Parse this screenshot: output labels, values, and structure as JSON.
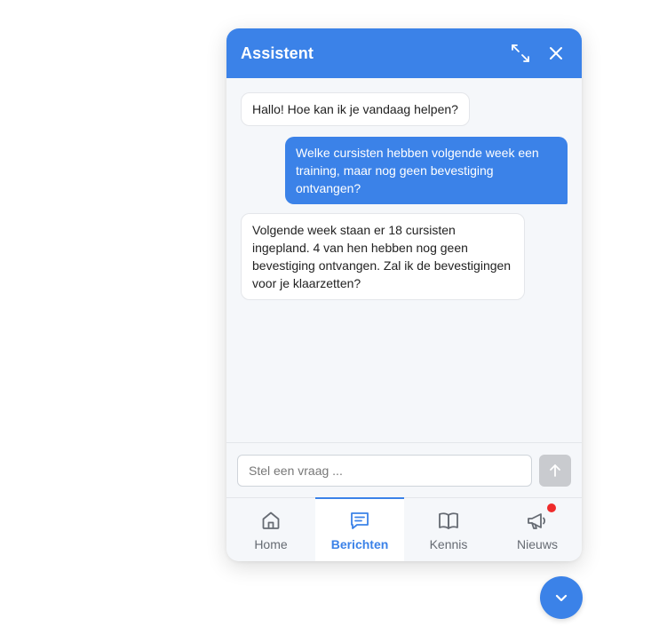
{
  "header": {
    "title": "Assistent",
    "expand_icon": "expand-icon",
    "close_icon": "close-icon"
  },
  "messages": [
    {
      "role": "assistant",
      "text": "Hallo! Hoe kan ik je vandaag helpen?"
    },
    {
      "role": "user",
      "text": "Welke cursisten hebben volgende week een training, maar nog geen bevestiging ontvangen?"
    },
    {
      "role": "assistant",
      "text": "Volgende week staan er 18 cursisten ingepland. 4 van hen hebben nog geen bevestiging ontvangen. Zal ik de bevestigingen voor je klaarzetten?"
    }
  ],
  "composer": {
    "placeholder": "Stel een vraag ...",
    "value": "",
    "send_icon": "arrow-up-icon"
  },
  "nav": {
    "items": [
      {
        "label": "Home",
        "icon": "home-icon",
        "active": false
      },
      {
        "label": "Berichten",
        "icon": "message-icon",
        "active": true
      },
      {
        "label": "Kennis",
        "icon": "book-icon",
        "active": false
      },
      {
        "label": "Nieuws",
        "icon": "megaphone-icon",
        "active": false,
        "badge": true
      }
    ]
  },
  "launcher": {
    "icon": "chevron-down-icon"
  },
  "colors": {
    "accent": "#3b82e8",
    "badge": "#ef2b2b",
    "send_disabled": "#c9cbcf"
  }
}
